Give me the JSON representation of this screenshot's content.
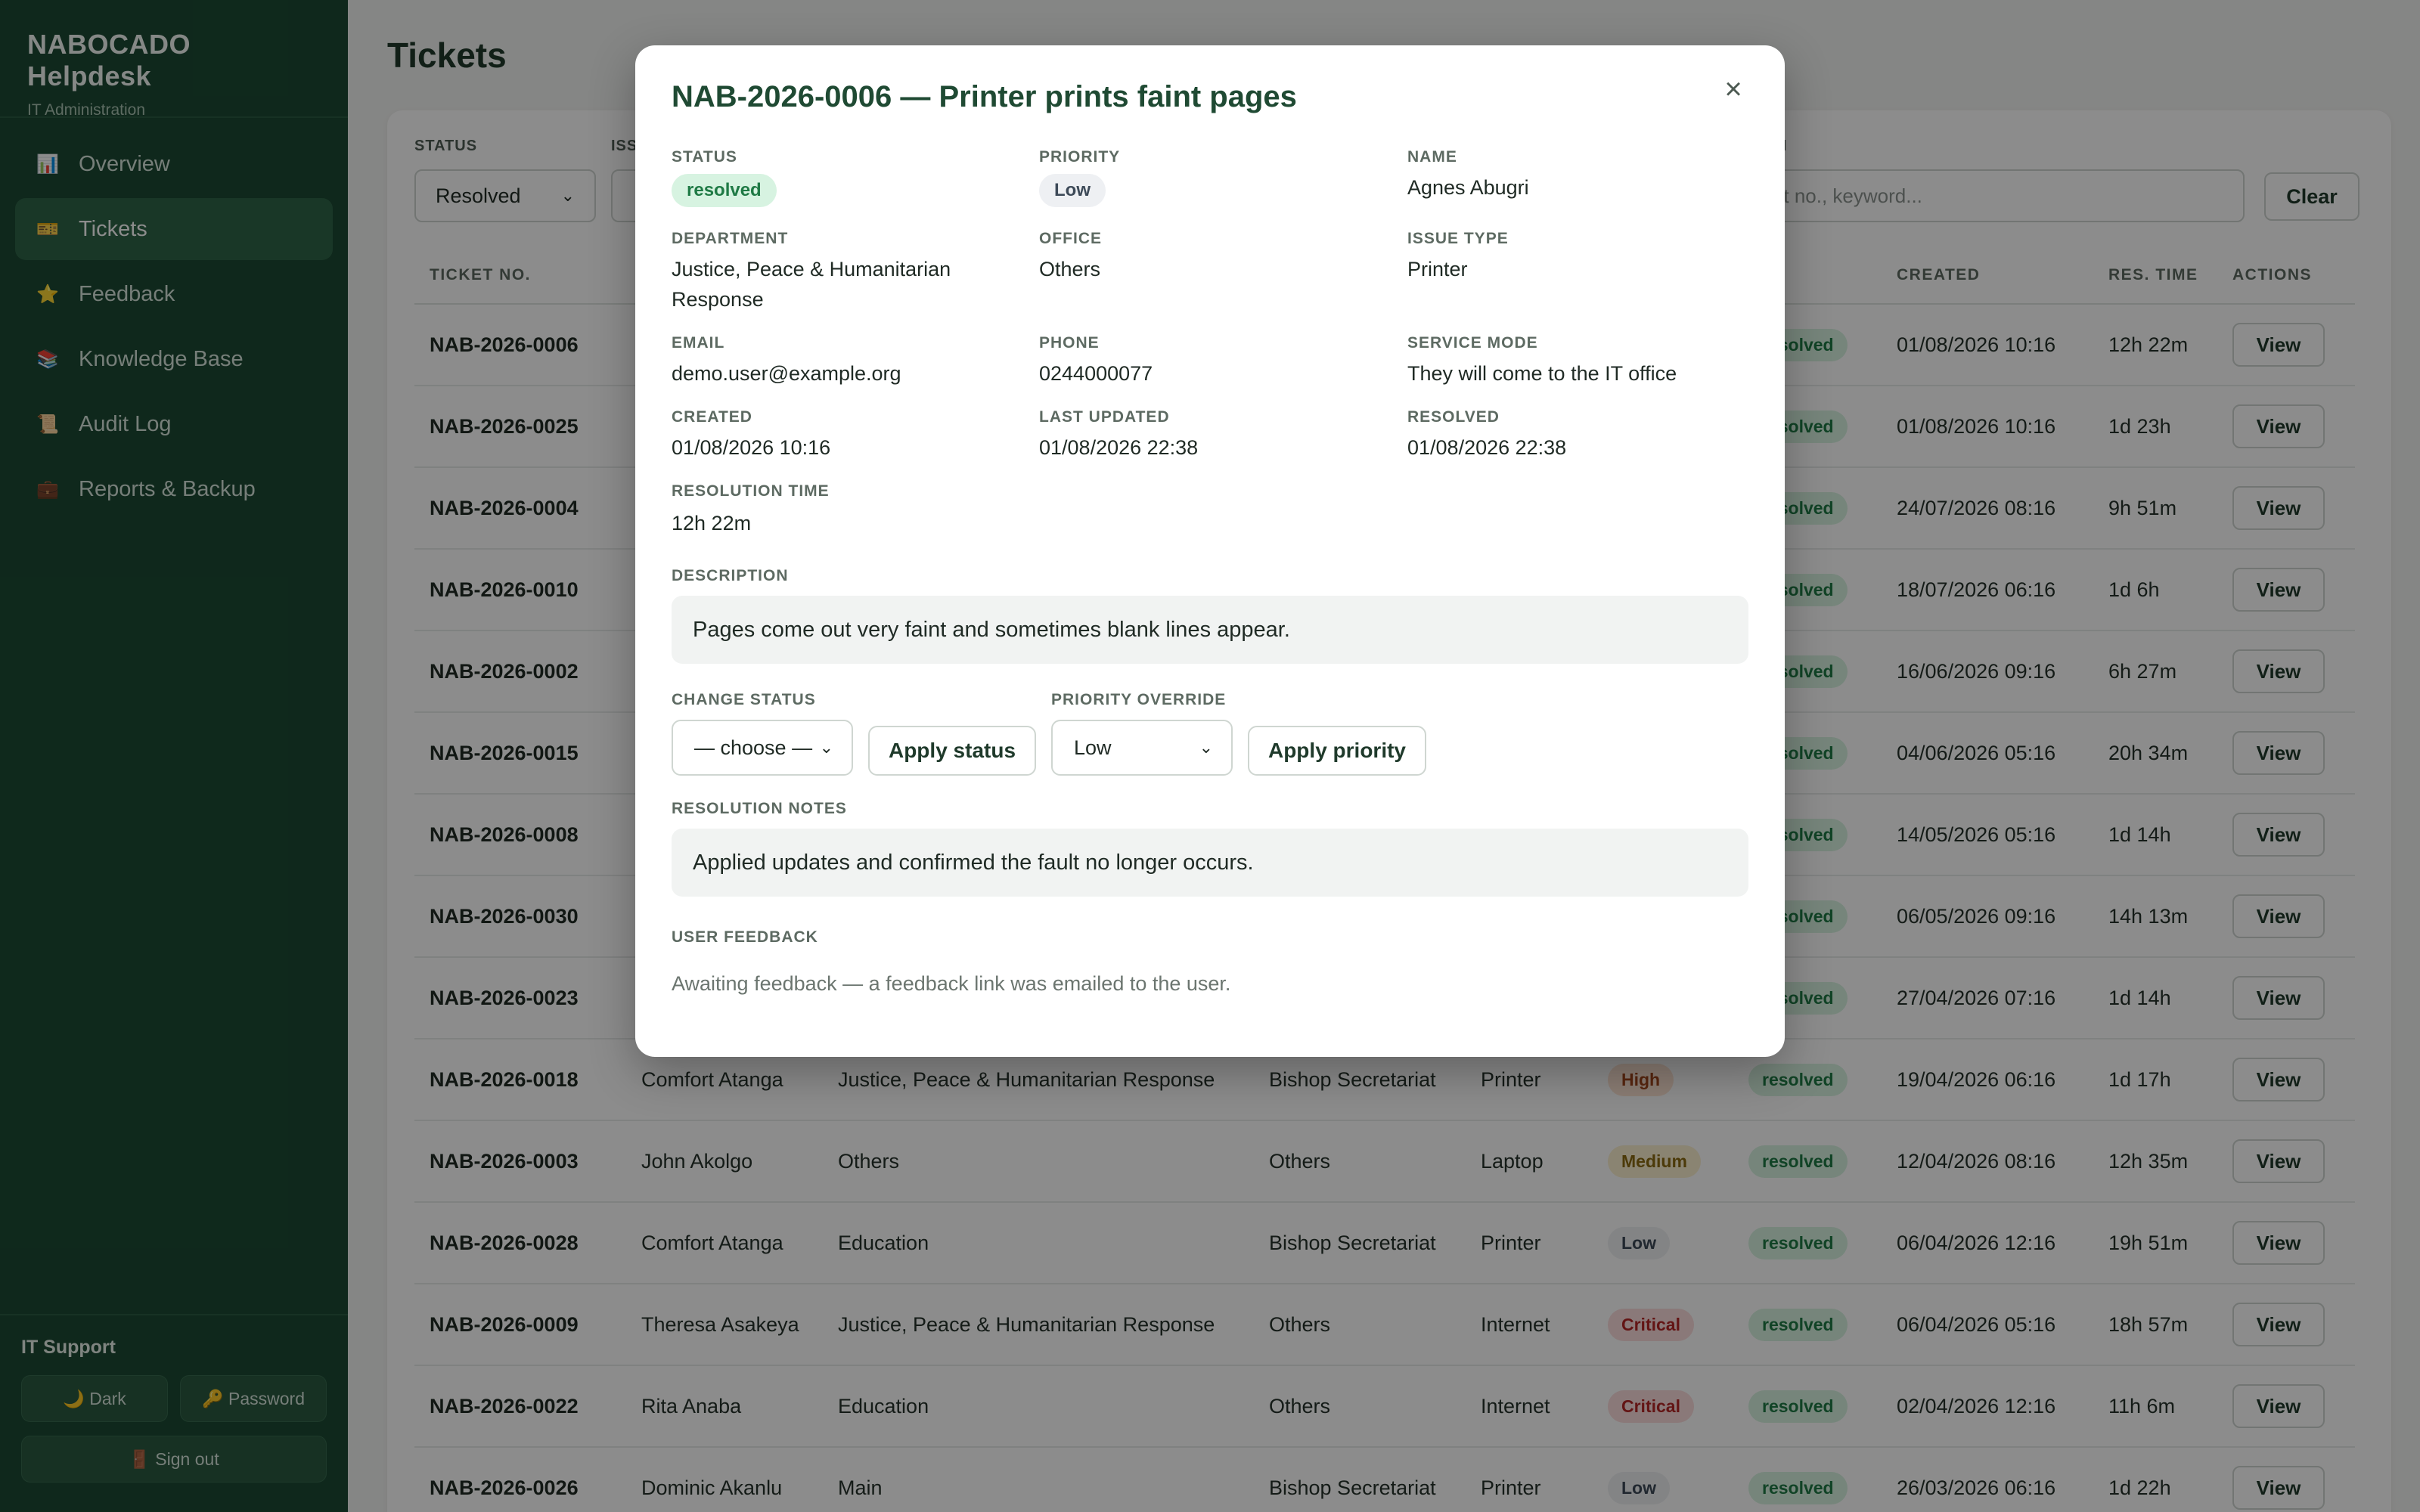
{
  "app": {
    "title": "NABOCADO Helpdesk",
    "subtitle": "IT Administration"
  },
  "sidebar": {
    "items": [
      {
        "label": "Overview",
        "icon": "chart-icon",
        "glyph": "📊"
      },
      {
        "label": "Tickets",
        "icon": "ticket-icon",
        "glyph": "🎫"
      },
      {
        "label": "Feedback",
        "icon": "star-icon",
        "glyph": "⭐"
      },
      {
        "label": "Knowledge Base",
        "icon": "books-icon",
        "glyph": "📚"
      },
      {
        "label": "Audit Log",
        "icon": "log-icon",
        "glyph": "📜"
      },
      {
        "label": "Reports & Backup",
        "icon": "backup-icon",
        "glyph": "💼"
      }
    ],
    "footer": {
      "role": "IT Support",
      "dark_label": "🌙 Dark",
      "password_label": "🔑 Password",
      "signout_label": "🚪 Sign out"
    }
  },
  "page": {
    "title": "Tickets"
  },
  "filters": {
    "status_label": "STATUS",
    "status_value": "Resolved",
    "issue_label": "ISS",
    "search_label": "H",
    "search_placeholder": "e, ticket no., keyword...",
    "clear_label": "Clear"
  },
  "table": {
    "headers": {
      "ticket_no": "TICKET NO.",
      "status": "TUS",
      "created": "CREATED",
      "res_time": "RES. TIME",
      "actions": "ACTIONS"
    },
    "view_label": "View",
    "rows": [
      {
        "no": "NAB-2026-0006",
        "name": "",
        "dept": "",
        "office": "",
        "type": "",
        "priority": "",
        "ptype": "",
        "status": "resolved",
        "created": "01/08/2026 10:16",
        "res": "12h 22m"
      },
      {
        "no": "NAB-2026-0025",
        "name": "",
        "dept": "",
        "office": "",
        "type": "",
        "priority": "",
        "ptype": "",
        "status": "resolved",
        "created": "01/08/2026 10:16",
        "res": "1d 23h"
      },
      {
        "no": "NAB-2026-0004",
        "name": "",
        "dept": "",
        "office": "",
        "type": "",
        "priority": "",
        "ptype": "",
        "status": "resolved",
        "created": "24/07/2026 08:16",
        "res": "9h 51m"
      },
      {
        "no": "NAB-2026-0010",
        "name": "",
        "dept": "",
        "office": "",
        "type": "",
        "priority": "",
        "ptype": "",
        "status": "resolved",
        "created": "18/07/2026 06:16",
        "res": "1d 6h"
      },
      {
        "no": "NAB-2026-0002",
        "name": "",
        "dept": "",
        "office": "",
        "type": "",
        "priority": "",
        "ptype": "",
        "status": "resolved",
        "created": "16/06/2026 09:16",
        "res": "6h 27m"
      },
      {
        "no": "NAB-2026-0015",
        "name": "",
        "dept": "",
        "office": "",
        "type": "",
        "priority": "",
        "ptype": "",
        "status": "resolved",
        "created": "04/06/2026 05:16",
        "res": "20h 34m"
      },
      {
        "no": "NAB-2026-0008",
        "name": "",
        "dept": "",
        "office": "",
        "type": "",
        "priority": "",
        "ptype": "",
        "status": "resolved",
        "created": "14/05/2026 05:16",
        "res": "1d 14h"
      },
      {
        "no": "NAB-2026-0030",
        "name": "",
        "dept": "",
        "office": "",
        "type": "",
        "priority": "",
        "ptype": "",
        "status": "resolved",
        "created": "06/05/2026 09:16",
        "res": "14h 13m"
      },
      {
        "no": "NAB-2026-0023",
        "name": "",
        "dept": "",
        "office": "",
        "type": "",
        "priority": "",
        "ptype": "",
        "status": "resolved",
        "created": "27/04/2026 07:16",
        "res": "1d 14h"
      },
      {
        "no": "NAB-2026-0018",
        "name": "Comfort Atanga",
        "dept": "Justice, Peace & Humanitarian Response",
        "office": "Bishop Secretariat",
        "type": "Printer",
        "priority": "High",
        "ptype": "high",
        "status": "resolved",
        "created": "19/04/2026 06:16",
        "res": "1d 17h"
      },
      {
        "no": "NAB-2026-0003",
        "name": "John Akolgo",
        "dept": "Others",
        "office": "Others",
        "type": "Laptop",
        "priority": "Medium",
        "ptype": "medium",
        "status": "resolved",
        "created": "12/04/2026 08:16",
        "res": "12h 35m"
      },
      {
        "no": "NAB-2026-0028",
        "name": "Comfort Atanga",
        "dept": "Education",
        "office": "Bishop Secretariat",
        "type": "Printer",
        "priority": "Low",
        "ptype": "low",
        "status": "resolved",
        "created": "06/04/2026 12:16",
        "res": "19h 51m"
      },
      {
        "no": "NAB-2026-0009",
        "name": "Theresa Asakeya",
        "dept": "Justice, Peace & Humanitarian Response",
        "office": "Others",
        "type": "Internet",
        "priority": "Critical",
        "ptype": "critical",
        "status": "resolved",
        "created": "06/04/2026 05:16",
        "res": "18h 57m"
      },
      {
        "no": "NAB-2026-0022",
        "name": "Rita Anaba",
        "dept": "Education",
        "office": "Others",
        "type": "Internet",
        "priority": "Critical",
        "ptype": "critical",
        "status": "resolved",
        "created": "02/04/2026 12:16",
        "res": "11h 6m"
      },
      {
        "no": "NAB-2026-0026",
        "name": "Dominic Akanlu",
        "dept": "Main",
        "office": "Bishop Secretariat",
        "type": "Printer",
        "priority": "Low",
        "ptype": "low",
        "status": "resolved",
        "created": "26/03/2026 06:16",
        "res": "1d 22h"
      }
    ]
  },
  "modal": {
    "title": "NAB-2026-0006 — Printer prints faint pages",
    "close_glyph": "×",
    "status_label": "STATUS",
    "status_value": "resolved",
    "priority_label": "PRIORITY",
    "priority_value": "Low",
    "name_label": "NAME",
    "name_value": "Agnes Abugri",
    "department_label": "DEPARTMENT",
    "department_value": "Justice, Peace & Humanitarian Response",
    "office_label": "OFFICE",
    "office_value": "Others",
    "issue_type_label": "ISSUE TYPE",
    "issue_type_value": "Printer",
    "email_label": "EMAIL",
    "email_value": "demo.user@example.org",
    "phone_label": "PHONE",
    "phone_value": "0244000077",
    "service_mode_label": "SERVICE MODE",
    "service_mode_value": "They will come to the IT office",
    "created_label": "CREATED",
    "created_value": "01/08/2026 10:16",
    "last_updated_label": "LAST UPDATED",
    "last_updated_value": "01/08/2026 22:38",
    "resolved_label": "RESOLVED",
    "resolved_value": "01/08/2026 22:38",
    "resolution_time_label": "RESOLUTION TIME",
    "resolution_time_value": "12h 22m",
    "description_label": "DESCRIPTION",
    "description_value": "Pages come out very faint and sometimes blank lines appear.",
    "change_status_label": "CHANGE STATUS",
    "change_status_value": "— choose —",
    "apply_status_label": "Apply status",
    "priority_override_label": "PRIORITY OVERRIDE",
    "priority_override_value": "Low",
    "apply_priority_label": "Apply priority",
    "resolution_notes_label": "RESOLUTION NOTES",
    "resolution_notes_value": "Applied updates and confirmed the fault no longer occurs.",
    "user_feedback_label": "USER FEEDBACK",
    "user_feedback_value": "Awaiting feedback — a feedback link was emailed to the user."
  }
}
